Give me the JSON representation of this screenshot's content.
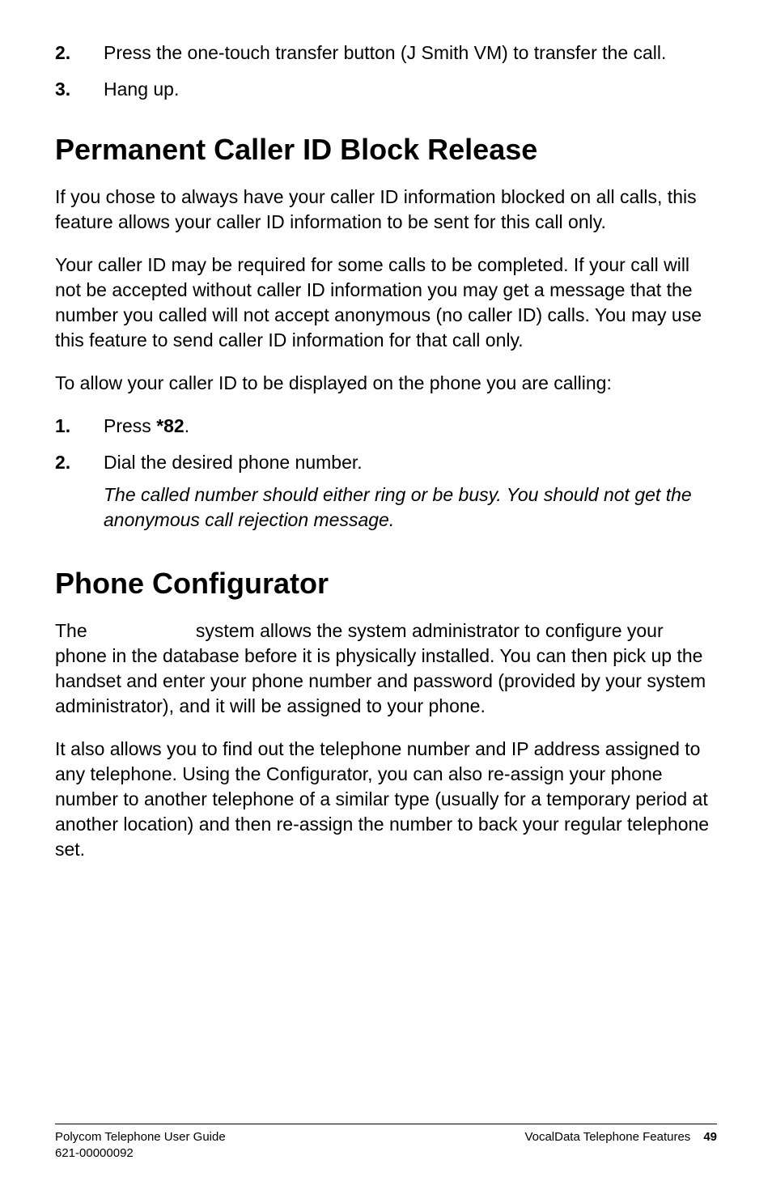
{
  "list1": {
    "items": [
      {
        "num": "2.",
        "text": "Press the one-touch transfer button (J Smith VM) to transfer the call."
      },
      {
        "num": "3.",
        "text": "Hang up."
      }
    ]
  },
  "section1": {
    "heading": "Permanent Caller ID Block Release",
    "p1": "If you chose to always have your caller ID information blocked on all calls, this feature allows your caller ID information to be sent for this call only.",
    "p2": "Your caller ID may be required for some calls to be completed. If your call will not be accepted without caller ID information you may get a message that the number you called will not accept anonymous (no caller ID) calls. You may use this feature to send caller ID information for that call only.",
    "p3": "To allow your caller ID to be displayed on the phone you are calling:",
    "steps": [
      {
        "num": "1.",
        "prefix": "Press ",
        "bold": "*82",
        "suffix": "."
      },
      {
        "num": "2.",
        "prefix": "Dial the desired phone number.",
        "bold": "",
        "suffix": ""
      }
    ],
    "note": "The called number should either ring or be busy. You should not get the anonymous call rejection message."
  },
  "section2": {
    "heading": "Phone Configurator",
    "p1_prefix": "The ",
    "p1_gap": "                    ",
    "p1_rest": "system allows the system administrator to configure your phone in the database before it is physically installed. You can then pick up the handset and enter your phone number and password (provided by your system administrator), and it will be assigned to your phone.",
    "p2": "It also allows you to find out the telephone number and IP address assigned to any telephone. Using the Configurator, you can also re-assign your phone number to another telephone of a similar type (usually for a temporary period at another location) and then re-assign the number to back your regular telephone set."
  },
  "footer": {
    "left1": "Polycom Telephone User Guide",
    "left2": "621-00000092",
    "right_label": "VocalData Telephone Features",
    "page": "49"
  }
}
